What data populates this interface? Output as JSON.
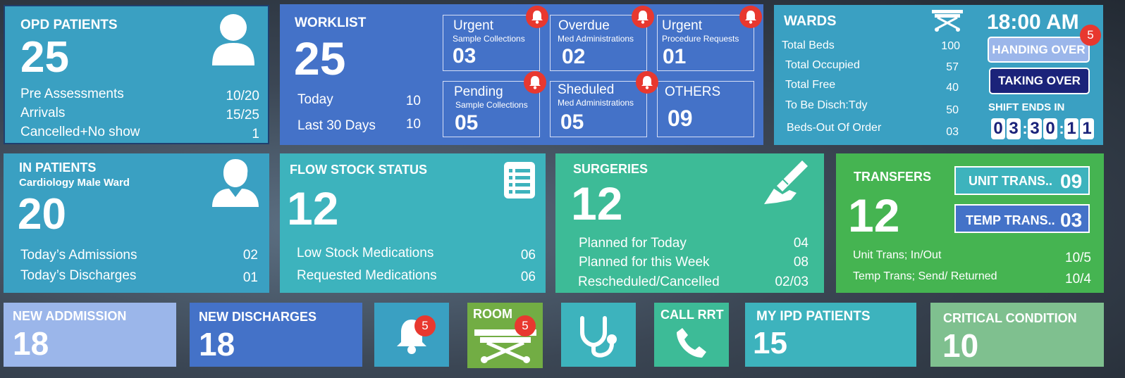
{
  "opd": {
    "title": "OPD PATIENTS",
    "count": "25",
    "rows": [
      {
        "label": "Pre Assessments",
        "value": "10/20"
      },
      {
        "label": "Arrivals",
        "value": "15/25"
      },
      {
        "label": "Cancelled+No show",
        "value": "1"
      }
    ]
  },
  "worklist": {
    "title": "WORKLIST",
    "count": "25",
    "rows": [
      {
        "label": "Today",
        "value": "10"
      },
      {
        "label": "Last 30 Days",
        "value": "10"
      }
    ],
    "boxes": [
      {
        "title": "Urgent",
        "sub": "Sample Collections",
        "value": "03"
      },
      {
        "title": "Overdue",
        "sub": "Med Administrations",
        "value": "02"
      },
      {
        "title": "Urgent",
        "sub": "Procedure Requests",
        "value": "01"
      },
      {
        "title": "Pending",
        "sub": "Sample Collections",
        "value": "05"
      },
      {
        "title": "Sheduled",
        "sub": "Med Administrations",
        "value": "05"
      },
      {
        "title": "OTHERS",
        "sub": "",
        "value": "09"
      }
    ]
  },
  "wards": {
    "title": "WARDS",
    "rows": [
      {
        "label": "Total Beds",
        "value": "100"
      },
      {
        "label": "Total Occupied",
        "value": "57"
      },
      {
        "label": "Total Free",
        "value": "40"
      },
      {
        "label": "To Be Disch:Tdy",
        "value": "50"
      },
      {
        "label": "Beds-Out Of Order",
        "value": "03"
      }
    ],
    "time": "18:00 AM",
    "handing_over": "HANDING OVER",
    "handing_badge": "5",
    "taking_over": "TAKING OVER",
    "shift_label": "SHIFT ENDS IN",
    "shift_digits": [
      "0",
      "3",
      "3",
      "0",
      "1",
      "1"
    ]
  },
  "inpatients": {
    "title": "IN PATIENTS",
    "subtitle": "Cardiology Male Ward",
    "count": "20",
    "rows": [
      {
        "label": "Today’s Admissions",
        "value": "02"
      },
      {
        "label": "Today’s Discharges",
        "value": "01"
      }
    ]
  },
  "flowstock": {
    "title": "FLOW STOCK STATUS",
    "count": "12",
    "rows": [
      {
        "label": "Low Stock Medications",
        "value": "06"
      },
      {
        "label": "Requested Medications",
        "value": "06"
      }
    ]
  },
  "surgeries": {
    "title": "SURGERIES",
    "count": "12",
    "rows": [
      {
        "label": "Planned for Today",
        "value": "04"
      },
      {
        "label": "Planned for this Week",
        "value": "08"
      },
      {
        "label": "Rescheduled/Cancelled",
        "value": "02/03"
      }
    ]
  },
  "transfers": {
    "title": "TRANSFERS",
    "count": "12",
    "unit_trans_label": "UNIT TRANS..",
    "unit_trans_value": "09",
    "temp_trans_label": "TEMP TRANS..",
    "temp_trans_value": "03",
    "rows": [
      {
        "label": "Unit Trans; In/Out",
        "value": "10/5"
      },
      {
        "label": "Temp Trans; Send/ Returned",
        "value": "10/4"
      }
    ]
  },
  "bottom": {
    "new_admission": {
      "title": "NEW ADDMISSION",
      "count": "18"
    },
    "new_discharges": {
      "title": "NEW DISCHARGES",
      "count": "18"
    },
    "notifications_badge": "5",
    "room": {
      "title": "ROOM",
      "badge": "5"
    },
    "call_rrt": {
      "title": "CALL RRT"
    },
    "my_ipd": {
      "title": "MY IPD PATIENTS",
      "count": "15"
    },
    "critical": {
      "title": "CRITICAL CONDITION",
      "count": "10"
    }
  },
  "colors": {
    "teal_blue": "#3aa0c2",
    "royal_blue": "#4472c8",
    "turquoise": "#3db3bd",
    "green_teal": "#3dbb97",
    "green": "#45b451",
    "light_blue": "#9bb6ea",
    "olive_green": "#72ad44",
    "sage": "#7fc08f",
    "alert_red": "#e8382f",
    "navy": "#1b237a"
  },
  "icons": {
    "opd": "user-icon",
    "inpatients": "doctor-icon",
    "flowstock": "clipboard-list-icon",
    "surgeries": "scalpel-hand-icon",
    "wards": "bed-icon",
    "alerts": "bell-icon",
    "room": "stretcher-icon",
    "stethoscope": "stethoscope-icon",
    "call": "phone-icon"
  }
}
